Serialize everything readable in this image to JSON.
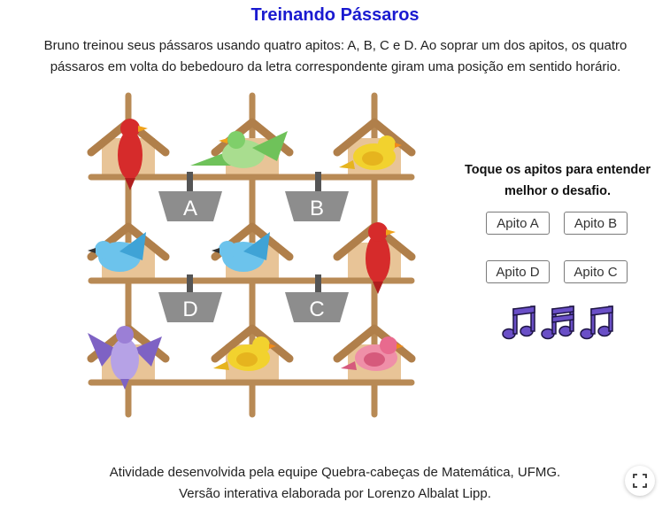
{
  "title": "Treinando Pássaros",
  "intro": {
    "line1": "Bruno treinou seus pássaros usando quatro apitos: A, B, C e D. Ao soprar um dos apitos, os quatro",
    "line2": "pássaros em volta do bebedouro da letra correspondente giram uma posição em sentido horário."
  },
  "board": {
    "feeders": [
      "A",
      "B",
      "D",
      "C"
    ],
    "birds": [
      {
        "house": "row1-col1",
        "color": "#d62b2b",
        "species": "cardinal"
      },
      {
        "house": "row1-col2",
        "color": "#7fcf6a",
        "species": "green-bird"
      },
      {
        "house": "row1-col3",
        "color": "#f2d22e",
        "species": "yellow-bird"
      },
      {
        "house": "row2-col1",
        "color": "#5bb8e6",
        "species": "blue-bird"
      },
      {
        "house": "row2-col2",
        "color": "#5bb8e6",
        "species": "blue-bird"
      },
      {
        "house": "row2-col3",
        "color": "#d62b2b",
        "species": "cardinal"
      },
      {
        "house": "row3-col1",
        "color": "#9b7fd6",
        "species": "purple-bird"
      },
      {
        "house": "row3-col2",
        "color": "#f2d22e",
        "species": "yellow-bird"
      },
      {
        "house": "row3-col3",
        "color": "#e86a8e",
        "species": "pink-bird"
      }
    ]
  },
  "prompt": {
    "line1": "Toque os apitos para entender",
    "line2": "melhor o desafio."
  },
  "buttons": {
    "apito_a": "Apito A",
    "apito_b": "Apito B",
    "apito_d": "Apito D",
    "apito_c": "Apito C"
  },
  "notes_icons": [
    "eighth-notes-icon",
    "sixteenth-notes-icon",
    "eighth-notes-icon"
  ],
  "notes_color": "#6a4fc7",
  "footer": {
    "line1": "Atividade desenvolvida pela equipe Quebra-cabeças de Matemática, UFMG.",
    "line2": "Versão interativa elaborada por Lorenzo Albalat Lipp."
  },
  "fullscreen_icon": "fullscreen-icon"
}
